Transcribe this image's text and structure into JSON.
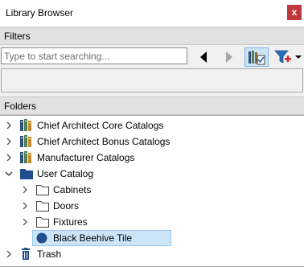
{
  "window": {
    "title": "Library Browser",
    "close_label": "x"
  },
  "filters": {
    "header": "Filters",
    "search_placeholder": "Type to start searching..."
  },
  "folders": {
    "header": "Folders",
    "items": [
      {
        "label": "Chief Architect Core Catalogs",
        "icon": "catalog-books-icon",
        "expanded": false
      },
      {
        "label": "Chief Architect Bonus Catalogs",
        "icon": "catalog-books-icon",
        "expanded": false
      },
      {
        "label": "Manufacturer Catalogs",
        "icon": "catalog-books-icon",
        "expanded": false
      },
      {
        "label": "User Catalog",
        "icon": "folder-filled-icon",
        "expanded": true
      },
      {
        "label": "Cabinets",
        "icon": "folder-outline-icon",
        "expanded": false
      },
      {
        "label": "Doors",
        "icon": "folder-outline-icon",
        "expanded": false
      },
      {
        "label": "Fixtures",
        "icon": "folder-outline-icon",
        "expanded": false
      },
      {
        "label": "Black Beehive Tile",
        "icon": "material-circle-icon",
        "selected": true
      },
      {
        "label": "Trash",
        "icon": "trash-icon",
        "expanded": false
      }
    ]
  },
  "colors": {
    "selection_bg": "#cce4f7",
    "close_button": "#c0383b",
    "header_bg": "#e1e1e1"
  }
}
